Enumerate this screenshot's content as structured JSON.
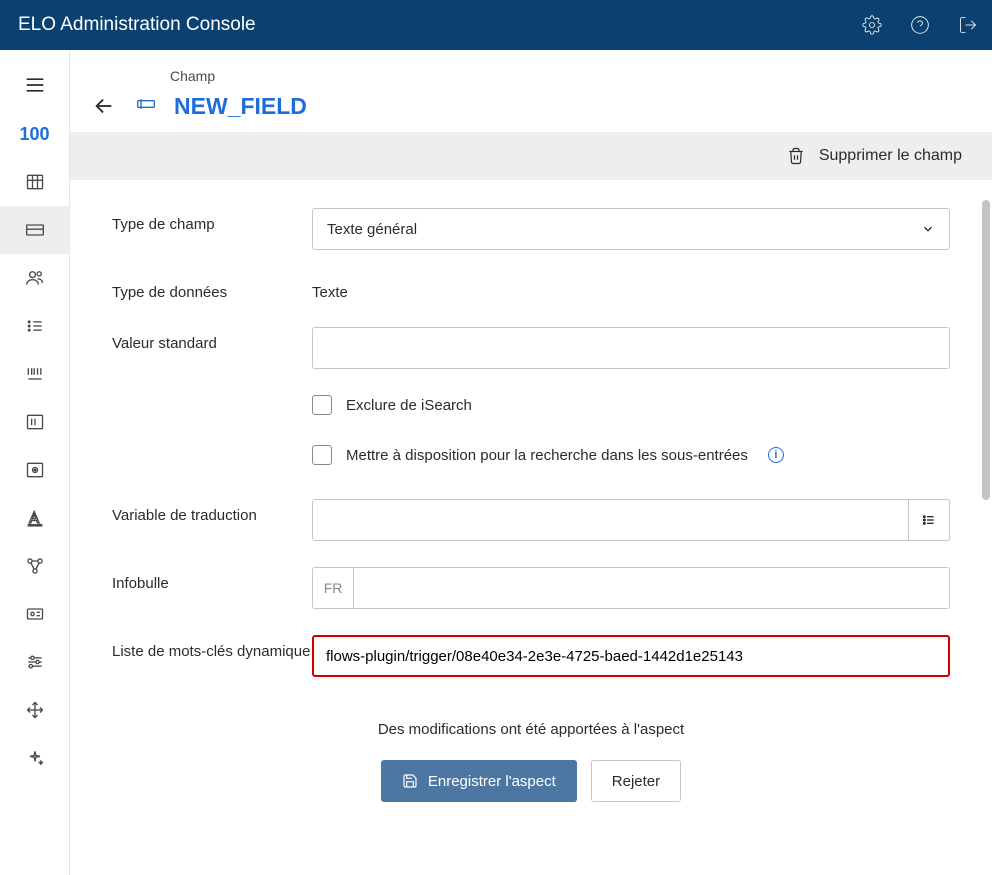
{
  "app_title": "ELO Administration Console",
  "sidebar": {
    "count": "100"
  },
  "breadcrumb": "Champ",
  "page_title": "NEW_FIELD",
  "delete_label": "Supprimer le champ",
  "form": {
    "field_type_label": "Type de champ",
    "field_type_value": "Texte général",
    "data_type_label": "Type de données",
    "data_type_value": "Texte",
    "default_value_label": "Valeur standard",
    "default_value": "",
    "exclude_isearch_label": "Exclure de iSearch",
    "sub_search_label": "Mettre à disposition pour la recherche dans les sous-entrées",
    "translation_var_label": "Variable de traduction",
    "translation_var_value": "",
    "tooltip_label": "Infobulle",
    "tooltip_lang": "FR",
    "tooltip_value": "",
    "dynamic_keywords_label": "Liste de mots-clés dynamique",
    "dynamic_keywords_value": "flows-plugin/trigger/08e40e34-2e3e-4725-baed-1442d1e25143"
  },
  "footer": {
    "changes_msg": "Des modifications ont été apportées à l'aspect",
    "save_label": "Enregistrer l'aspect",
    "reject_label": "Rejeter"
  }
}
